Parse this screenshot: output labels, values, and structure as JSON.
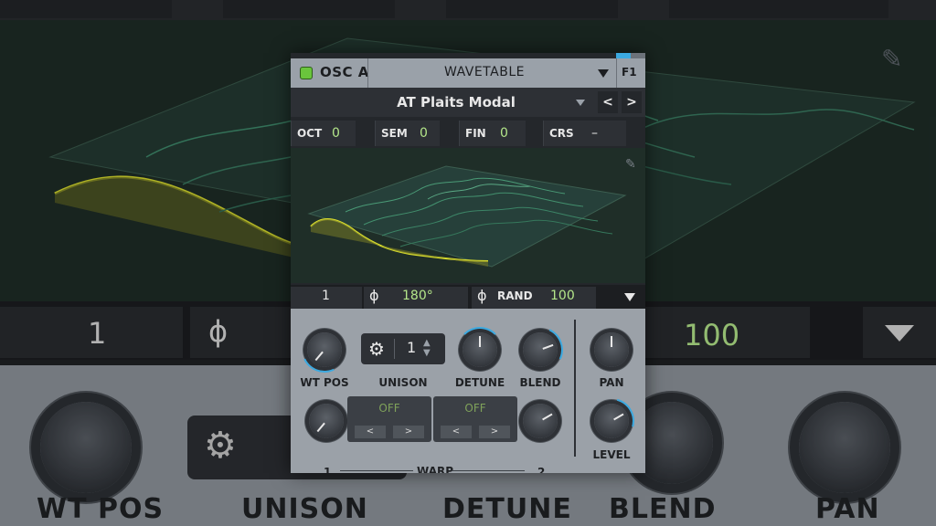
{
  "background": {
    "params_top": [
      {
        "label": "OCT",
        "value": "0"
      },
      {
        "label": "SEM",
        "value": "0"
      },
      {
        "label": "FIN",
        "value": "0"
      },
      {
        "label": "CRS",
        "value": ""
      }
    ],
    "unison_value": "1",
    "rand_value": "100",
    "knob_labels": [
      "WT POS",
      "UNISON",
      "DETUNE",
      "BLEND",
      "PAN"
    ]
  },
  "panel": {
    "osc_title": "OSC A",
    "mode": "WAVETABLE",
    "filter_route": "F1",
    "preset_name": "AT Plaits Modal",
    "nav_prev": "<",
    "nav_next": ">",
    "params": [
      {
        "label": "OCT",
        "value": "0"
      },
      {
        "label": "SEM",
        "value": "0"
      },
      {
        "label": "FIN",
        "value": "0"
      },
      {
        "label": "CRS",
        "value": "–"
      }
    ],
    "phase_symbol": "ϕ",
    "bottom": {
      "unison_voices": "1",
      "phase_value": "180°",
      "rand_label": "RAND",
      "rand_value": "100"
    },
    "knobs": {
      "wt_pos": "WT POS",
      "unison": "UNISON",
      "unison_value": "1",
      "detune": "DETUNE",
      "blend": "BLEND",
      "pan": "PAN",
      "level": "LEVEL",
      "warp": "WARP",
      "warp1_num": "1",
      "warp2_num": "2",
      "warp1_state": "OFF",
      "warp2_state": "OFF",
      "warp_prev": "<",
      "warp_next": ">"
    },
    "colors": {
      "led": "#6ac53c",
      "accent": "#3ba9e0",
      "value_green": "#b4e68a",
      "wave_yellow": "#d8dc2e"
    }
  }
}
